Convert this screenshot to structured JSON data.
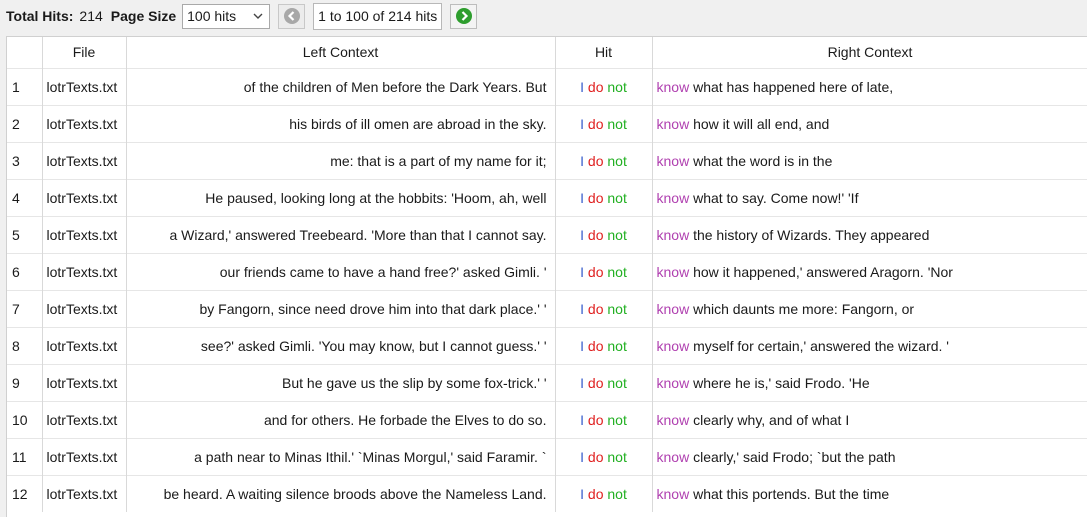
{
  "toolbar": {
    "total_hits_label": "Total Hits:",
    "total_hits_value": "214",
    "page_size_label": "Page Size",
    "page_size_selected": "100 hits",
    "range_text": "1 to 100 of 214 hits"
  },
  "colors": {
    "hit_word_1": "#3a5fcd",
    "hit_word_2": "#e02020",
    "hit_word_3": "#22b022",
    "keyword": "#b040b0",
    "next_button": "#2e9e2e"
  },
  "table": {
    "headers": [
      "",
      "File",
      "Left Context",
      "Hit",
      "Right Context"
    ],
    "rows": [
      {
        "num": "1",
        "file": "lotrTexts.txt",
        "left": "of the children of Men before the Dark Years. But",
        "hit": [
          "I",
          "do",
          "not"
        ],
        "kw": "know",
        "right": "what has happened here of late,"
      },
      {
        "num": "2",
        "file": "lotrTexts.txt",
        "left": "his birds of ill omen are abroad in the sky.",
        "hit": [
          "I",
          "do",
          "not"
        ],
        "kw": "know",
        "right": "how it will all end, and"
      },
      {
        "num": "3",
        "file": "lotrTexts.txt",
        "left": "me: that is a part of my name for it;",
        "hit": [
          "I",
          "do",
          "not"
        ],
        "kw": "know",
        "right": "what the word is in the"
      },
      {
        "num": "4",
        "file": "lotrTexts.txt",
        "left": "He paused, looking long at the hobbits: 'Hoom, ah, well",
        "hit": [
          "I",
          "do",
          "not"
        ],
        "kw": "know",
        "right": "what to say. Come now!' 'If"
      },
      {
        "num": "5",
        "file": "lotrTexts.txt",
        "left": "a Wizard,' answered Treebeard. 'More than that I cannot say.",
        "hit": [
          "I",
          "do",
          "not"
        ],
        "kw": "know",
        "right": "the history of Wizards. They appeared"
      },
      {
        "num": "6",
        "file": "lotrTexts.txt",
        "left": "our friends came to have a hand free?' asked Gimli. '",
        "hit": [
          "I",
          "do",
          "not"
        ],
        "kw": "know",
        "right": "how it happened,' answered Aragorn. 'Nor"
      },
      {
        "num": "7",
        "file": "lotrTexts.txt",
        "left": "by Fangorn, since need drove him into that dark place.' '",
        "hit": [
          "I",
          "do",
          "not"
        ],
        "kw": "know",
        "right": "which daunts me more: Fangorn, or"
      },
      {
        "num": "8",
        "file": "lotrTexts.txt",
        "left": "see?' asked Gimli. 'You may know, but I cannot guess.' '",
        "hit": [
          "I",
          "do",
          "not"
        ],
        "kw": "know",
        "right": "myself for certain,' answered the wizard. '"
      },
      {
        "num": "9",
        "file": "lotrTexts.txt",
        "left": "But he gave us the slip by some fox-trick.' '",
        "hit": [
          "I",
          "do",
          "not"
        ],
        "kw": "know",
        "right": "where he is,' said Frodo. 'He"
      },
      {
        "num": "10",
        "file": "lotrTexts.txt",
        "left": "and for others. He forbade the Elves to do so.",
        "hit": [
          "I",
          "do",
          "not"
        ],
        "kw": "know",
        "right": "clearly why, and of what I"
      },
      {
        "num": "11",
        "file": "lotrTexts.txt",
        "left": "a path near to Minas Ithil.' `Minas Morgul,' said Faramir. `",
        "hit": [
          "I",
          "do",
          "not"
        ],
        "kw": "know",
        "right": "clearly,' said Frodo; `but the path"
      },
      {
        "num": "12",
        "file": "lotrTexts.txt",
        "left": "be heard. A waiting silence broods above the Nameless Land.",
        "hit": [
          "I",
          "do",
          "not"
        ],
        "kw": "know",
        "right": "what this portends. But the time"
      }
    ]
  }
}
